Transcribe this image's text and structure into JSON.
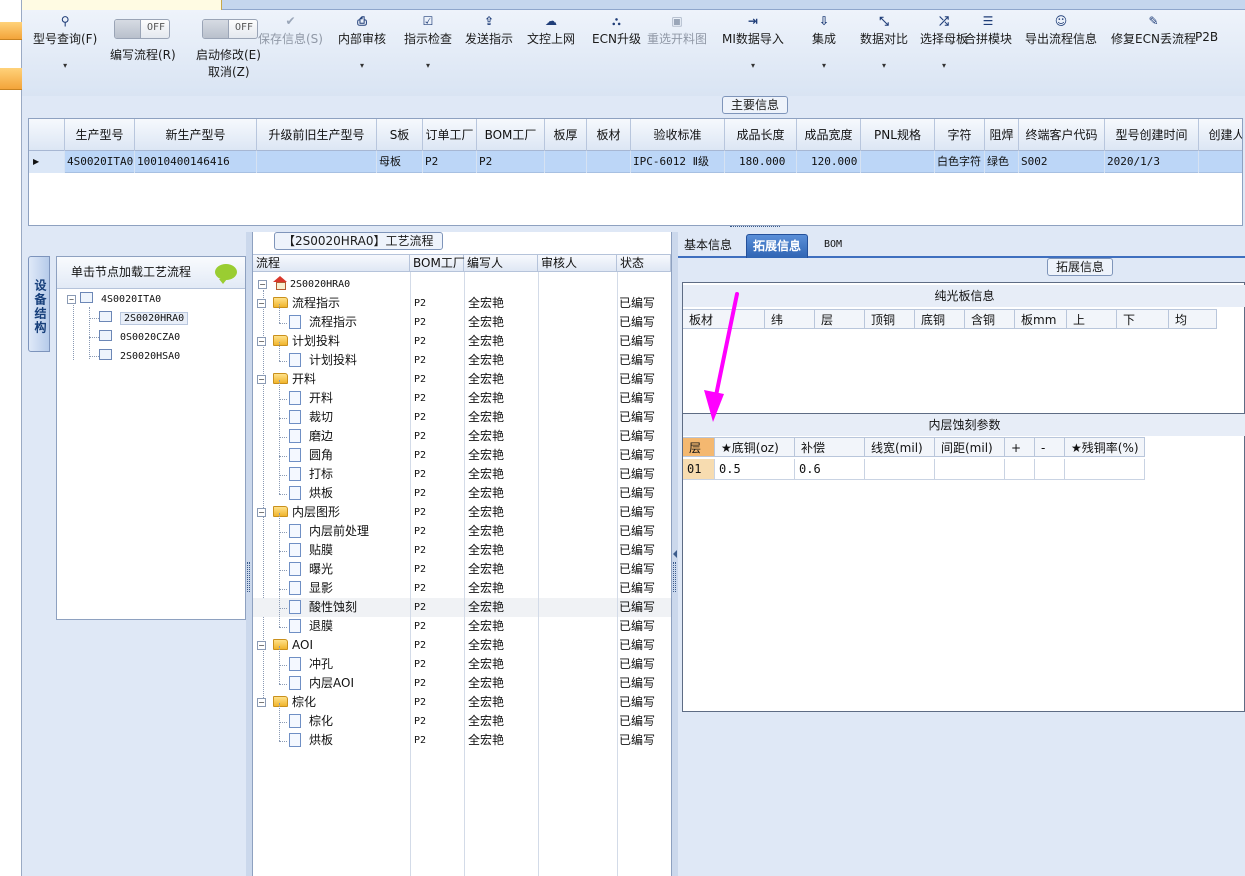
{
  "toolbar": {
    "items": [
      {
        "label": "型号查询(F)",
        "icon": "search-icon"
      },
      {
        "label": "保存信息(S)",
        "icon": "check-icon"
      },
      {
        "label": "内部审核",
        "icon": "printer-icon"
      },
      {
        "label": "指示检查",
        "icon": "checkbox-icon"
      },
      {
        "label": "发送指示",
        "icon": "upload-icon"
      },
      {
        "label": "文控上网",
        "icon": "cloud-upload-icon"
      },
      {
        "label": "ECN升级",
        "icon": "binoculars-icon"
      },
      {
        "label": "重选开料图",
        "icon": "image-icon"
      },
      {
        "label": "MI数据导入",
        "icon": "sign-in-icon"
      },
      {
        "label": "集成",
        "icon": "download-icon"
      },
      {
        "label": "数据对比",
        "icon": "compress-icon"
      },
      {
        "label": "选择母板",
        "icon": "shuffle-icon"
      },
      {
        "label": "合拼模块",
        "icon": "list-icon"
      },
      {
        "label": "导出流程信息",
        "icon": "smile-icon"
      },
      {
        "label": "修复ECN丢流程",
        "icon": "wrench-icon"
      },
      {
        "label": "P2B",
        "icon": ""
      }
    ],
    "toggle1": {
      "state": "OFF",
      "label": "编写流程(R)"
    },
    "toggle2": {
      "state": "OFF",
      "label1": "启动修改(E)",
      "label2": "取消(Z)"
    }
  },
  "main_group_title": "主要信息",
  "main_grid": {
    "columns": [
      "生产型号",
      "新生产型号",
      "升级前旧生产型号",
      "S板",
      "订单工厂",
      "BOM工厂",
      "板厚",
      "板材",
      "验收标准",
      "成品长度",
      "成品宽度",
      "PNL规格",
      "字符",
      "阻焊",
      "终端客户代码",
      "型号创建时间",
      "创建人"
    ],
    "row": [
      "4S0020ITA0",
      "10010400146416",
      "",
      "母板",
      "P2",
      "P2",
      "",
      "",
      "IPC-6012 Ⅱ级",
      "180.000",
      "120.000",
      "",
      "白色字符",
      "绿色",
      "S002",
      "2020/1/3",
      ""
    ]
  },
  "left_panel": {
    "vtab_label": "设备结构",
    "header": "单击节点加载工艺流程",
    "root": "4S0020ITA0",
    "children": [
      "2S0020HRA0",
      "0S0020CZA0",
      "2S0020HSA0"
    ]
  },
  "process": {
    "title": "【2S0020HRA0】工艺流程",
    "columns": [
      "流程",
      "BOM工厂",
      "编写人",
      "审核人",
      "状态"
    ],
    "root": "2S0020HRA0",
    "rows": [
      {
        "name": "流程指示",
        "type": "folder",
        "bom": "P2",
        "editor": "全宏艳",
        "status": "已编写"
      },
      {
        "name": "流程指示",
        "type": "doc",
        "bom": "P2",
        "editor": "全宏艳",
        "status": "已编写"
      },
      {
        "name": "计划投料",
        "type": "folder",
        "bom": "P2",
        "editor": "全宏艳",
        "status": "已编写"
      },
      {
        "name": "计划投料",
        "type": "doc",
        "bom": "P2",
        "editor": "全宏艳",
        "status": "已编写"
      },
      {
        "name": "开料",
        "type": "folder",
        "bom": "P2",
        "editor": "全宏艳",
        "status": "已编写"
      },
      {
        "name": "开料",
        "type": "doc",
        "bom": "P2",
        "editor": "全宏艳",
        "status": "已编写"
      },
      {
        "name": "裁切",
        "type": "doc",
        "bom": "P2",
        "editor": "全宏艳",
        "status": "已编写"
      },
      {
        "name": "磨边",
        "type": "doc",
        "bom": "P2",
        "editor": "全宏艳",
        "status": "已编写"
      },
      {
        "name": "圆角",
        "type": "doc",
        "bom": "P2",
        "editor": "全宏艳",
        "status": "已编写"
      },
      {
        "name": "打标",
        "type": "doc",
        "bom": "P2",
        "editor": "全宏艳",
        "status": "已编写"
      },
      {
        "name": "烘板",
        "type": "doc",
        "bom": "P2",
        "editor": "全宏艳",
        "status": "已编写"
      },
      {
        "name": "内层图形",
        "type": "folder",
        "bom": "P2",
        "editor": "全宏艳",
        "status": "已编写"
      },
      {
        "name": "内层前处理",
        "type": "doc",
        "bom": "P2",
        "editor": "全宏艳",
        "status": "已编写"
      },
      {
        "name": "贴膜",
        "type": "doc",
        "bom": "P2",
        "editor": "全宏艳",
        "status": "已编写"
      },
      {
        "name": "曝光",
        "type": "doc",
        "bom": "P2",
        "editor": "全宏艳",
        "status": "已编写"
      },
      {
        "name": "显影",
        "type": "doc",
        "bom": "P2",
        "editor": "全宏艳",
        "status": "已编写"
      },
      {
        "name": "酸性蚀刻",
        "type": "doc",
        "bom": "P2",
        "editor": "全宏艳",
        "status": "已编写"
      },
      {
        "name": "退膜",
        "type": "doc",
        "bom": "P2",
        "editor": "全宏艳",
        "status": "已编写"
      },
      {
        "name": "AOI",
        "type": "folder",
        "bom": "P2",
        "editor": "全宏艳",
        "status": "已编写"
      },
      {
        "name": "冲孔",
        "type": "doc",
        "bom": "P2",
        "editor": "全宏艳",
        "status": "已编写"
      },
      {
        "name": "内层AOI",
        "type": "doc",
        "bom": "P2",
        "editor": "全宏艳",
        "status": "已编写"
      },
      {
        "name": "棕化",
        "type": "folder",
        "bom": "P2",
        "editor": "全宏艳",
        "status": "已编写"
      },
      {
        "name": "棕化",
        "type": "doc",
        "bom": "P2",
        "editor": "全宏艳",
        "status": "已编写"
      },
      {
        "name": "烘板",
        "type": "doc",
        "bom": "P2",
        "editor": "全宏艳",
        "status": "已编写"
      }
    ]
  },
  "right_panel": {
    "tabs": [
      "基本信息",
      "拓展信息",
      "BOM"
    ],
    "active_tab": "拓展信息",
    "group_title": "拓展信息",
    "plain_board": {
      "title": "纯光板信息",
      "columns": [
        "板材",
        "纬",
        "层",
        "顶铜",
        "底铜",
        "含铜",
        "板mm",
        "上",
        "下",
        "均"
      ]
    },
    "etch_params": {
      "title": "内层蚀刻参数",
      "columns": [
        "层",
        "★底铜(oz)",
        "补偿",
        "线宽(mil)",
        "间距(mil)",
        "+",
        "-",
        "★残铜率(%)"
      ],
      "rows": [
        [
          "01",
          "0.5",
          "0.6",
          "",
          "",
          "",
          "",
          ""
        ]
      ]
    }
  },
  "colors": {
    "annotation_arrow": "#ff00ff",
    "selection": "#bcd6f7",
    "active_tab": "#2f64b3"
  }
}
